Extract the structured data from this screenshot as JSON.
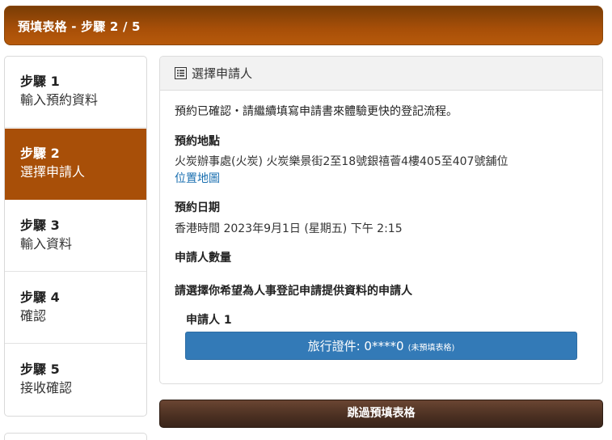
{
  "header": {
    "title": "預填表格 - 步驟 2 / 5"
  },
  "steps": [
    {
      "num": "步驟 1",
      "name": "輸入預約資料"
    },
    {
      "num": "步驟 2",
      "name": "選擇申請人"
    },
    {
      "num": "步驟 3",
      "name": "輸入資料"
    },
    {
      "num": "步驟 4",
      "name": "確認"
    },
    {
      "num": "步驟 5",
      "name": "接收確認"
    }
  ],
  "panel": {
    "title": "選擇申請人",
    "confirm_text": "預約已確認・請繼續填寫申請書來體驗更快的登記流程。",
    "location_label": "預約地點",
    "location_value": "火炭辦事處(火炭) 火炭樂景街2至18號銀禧薈4樓405至407號舖位",
    "map_link": "位置地圖",
    "date_label": "預約日期",
    "date_value": "香港時間 2023年9月1日 (星期五) 下午 2:15",
    "count_label": "申請人數量",
    "select_prompt": "請選擇你希望為人事登記申請提供資料的申請人",
    "applicant_label": "申請人 1",
    "applicant_button_main": "旅行證件: 0****0",
    "applicant_button_sub": "(未預填表格)"
  },
  "skip_button": "跳過預填表格"
}
